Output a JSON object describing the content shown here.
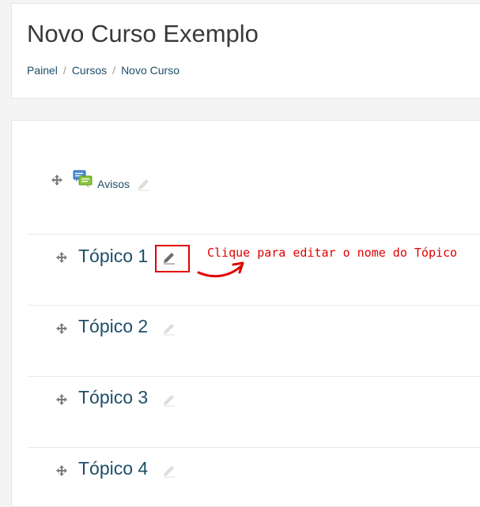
{
  "header": {
    "title": "Novo Curso Exemplo",
    "breadcrumb": [
      "Painel",
      "Cursos",
      "Novo Curso"
    ],
    "breadcrumb_separator": "/"
  },
  "course": {
    "announcements_label": "Avisos",
    "topics": [
      "Tópico 1",
      "Tópico 2",
      "Tópico 3",
      "Tópico 4"
    ]
  },
  "annotation": {
    "text": "Clique para editar o nome do Tópico",
    "color": "#e00000"
  },
  "colors": {
    "link": "#1d4f68",
    "title": "#373a3c"
  },
  "icons": {
    "move": "move-icon",
    "edit": "pencil-icon",
    "forum": "forum-icon"
  }
}
